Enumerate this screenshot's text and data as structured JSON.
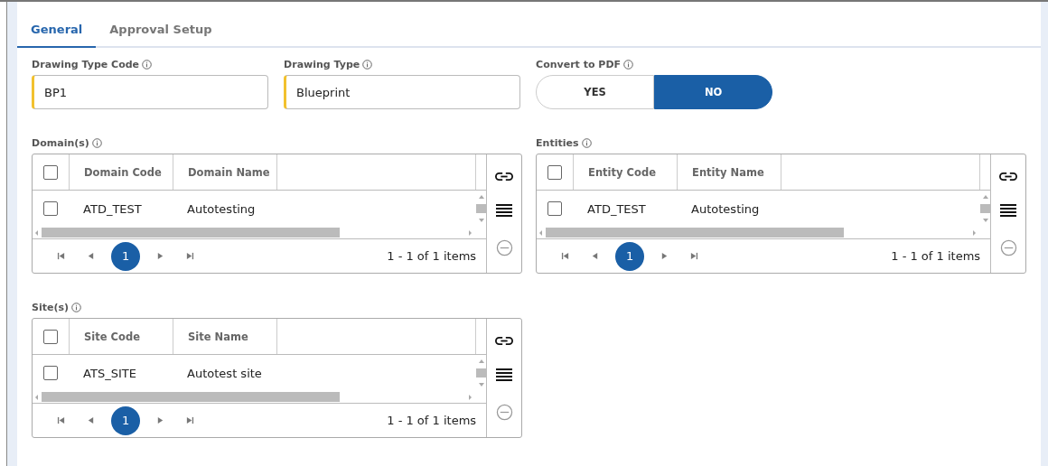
{
  "tabs": [
    {
      "label": "General",
      "selected": true
    },
    {
      "label": "Approval Setup",
      "selected": false
    }
  ],
  "fields": [
    {
      "kind": "text",
      "label": "Drawing Type Code",
      "value": "BP1",
      "required": true
    },
    {
      "kind": "text",
      "label": "Drawing Type",
      "value": "Blueprint",
      "required": true
    },
    {
      "kind": "toggle",
      "label": "Convert to PDF",
      "options": [
        {
          "label": "YES",
          "selected": false
        },
        {
          "label": "NO",
          "selected": true
        }
      ]
    }
  ],
  "grids": [
    {
      "label": "Domain(s)",
      "columns": [
        "Domain Code",
        "Domain Name"
      ],
      "rows": [
        {
          "checked": false,
          "cells": [
            "ATD_TEST",
            "Autotesting"
          ]
        }
      ],
      "header_checked": false,
      "page": "1",
      "summary": "1 - 1 of 1 items"
    },
    {
      "label": "Entities",
      "columns": [
        "Entity Code",
        "Entity Name"
      ],
      "rows": [
        {
          "checked": false,
          "cells": [
            "ATD_TEST",
            "Autotesting"
          ]
        }
      ],
      "header_checked": false,
      "page": "1",
      "summary": "1 - 1 of 1 items"
    },
    {
      "label": "Site(s)",
      "columns": [
        "Site Code",
        "Site Name"
      ],
      "rows": [
        {
          "checked": false,
          "cells": [
            "ATS_SITE",
            "Autotest site"
          ]
        }
      ],
      "header_checked": false,
      "page": "1",
      "summary": "1 - 1 of 1 items"
    }
  ]
}
